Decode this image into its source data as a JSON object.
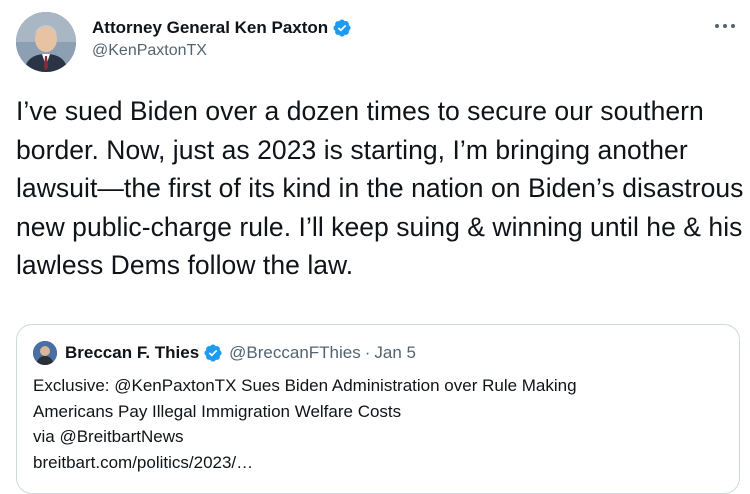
{
  "tweet": {
    "author": {
      "display_name": "Attorney General Ken Paxton",
      "handle": "@KenPaxtonTX",
      "verified": true
    },
    "more_icon": "more-horizontal-icon",
    "text": "I’ve sued Biden over a dozen times to secure our southern border. Now, just as 2023 is starting, I’m bringing another lawsuit—the first of its kind in the nation on Biden’s disastrous new public-charge rule. I’ll keep suing & winning until he & his lawless Dems follow the law."
  },
  "quote": {
    "display_name": "Breccan F. Thies",
    "handle": "@BreccanFThies",
    "separator": "·",
    "date": "Jan 5",
    "verified": true,
    "lines": [
      "Exclusive: @KenPaxtonTX Sues Biden Administration over Rule Making",
      "Americans Pay Illegal Immigration Welfare Costs",
      "via @BreitbartNews",
      "breitbart.com/politics/2023/…"
    ]
  },
  "colors": {
    "text_primary": "#0f1419",
    "text_secondary": "#536471",
    "verified_blue": "#1d9bf0",
    "border": "#cfd9de"
  }
}
